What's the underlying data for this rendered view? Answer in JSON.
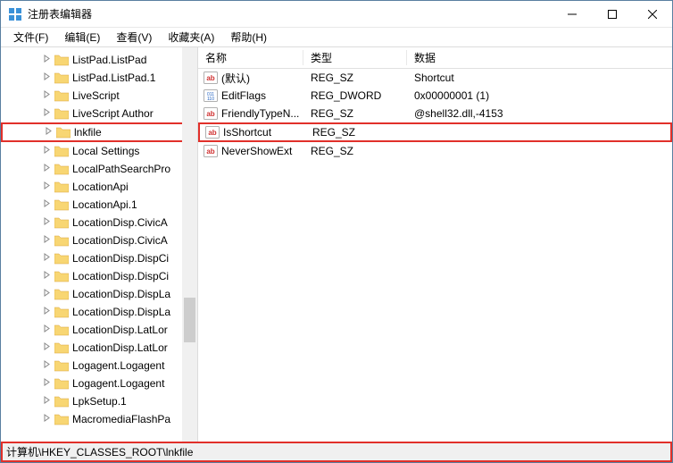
{
  "window": {
    "title": "注册表编辑器"
  },
  "menu": {
    "file": "文件(F)",
    "edit": "编辑(E)",
    "view": "查看(V)",
    "fav": "收藏夹(A)",
    "help": "帮助(H)"
  },
  "tree": {
    "items": [
      {
        "label": "ListPad.ListPad"
      },
      {
        "label": "ListPad.ListPad.1"
      },
      {
        "label": "LiveScript"
      },
      {
        "label": "LiveScript Author"
      },
      {
        "label": "lnkfile",
        "selected": true,
        "highlight": true
      },
      {
        "label": "Local Settings"
      },
      {
        "label": "LocalPathSearchPro"
      },
      {
        "label": "LocationApi"
      },
      {
        "label": "LocationApi.1"
      },
      {
        "label": "LocationDisp.CivicA"
      },
      {
        "label": "LocationDisp.CivicA"
      },
      {
        "label": "LocationDisp.DispCi"
      },
      {
        "label": "LocationDisp.DispCi"
      },
      {
        "label": "LocationDisp.DispLa"
      },
      {
        "label": "LocationDisp.DispLa"
      },
      {
        "label": "LocationDisp.LatLor"
      },
      {
        "label": "LocationDisp.LatLor"
      },
      {
        "label": "Logagent.Logagent"
      },
      {
        "label": "Logagent.Logagent"
      },
      {
        "label": "LpkSetup.1"
      },
      {
        "label": "MacromediaFlashPa"
      }
    ]
  },
  "grid": {
    "headers": {
      "name": "名称",
      "type": "类型",
      "data": "数据"
    },
    "rows": [
      {
        "icon": "sz",
        "name": "(默认)",
        "type": "REG_SZ",
        "data": "Shortcut"
      },
      {
        "icon": "dword",
        "name": "EditFlags",
        "type": "REG_DWORD",
        "data": "0x00000001 (1)"
      },
      {
        "icon": "sz",
        "name": "FriendlyTypeN...",
        "type": "REG_SZ",
        "data": "@shell32.dll,-4153"
      },
      {
        "icon": "sz",
        "name": "IsShortcut",
        "type": "REG_SZ",
        "data": "",
        "highlight": true
      },
      {
        "icon": "sz",
        "name": "NeverShowExt",
        "type": "REG_SZ",
        "data": ""
      }
    ]
  },
  "status": {
    "path": "计算机\\HKEY_CLASSES_ROOT\\lnkfile"
  }
}
